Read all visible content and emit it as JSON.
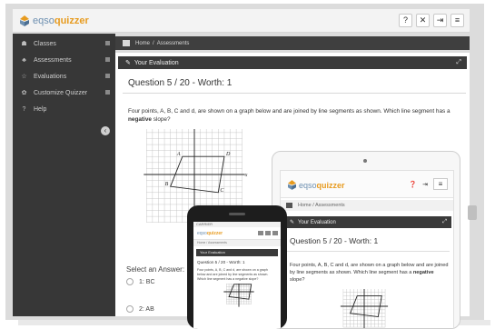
{
  "app": {
    "brand_light": "eqso",
    "brand_bold": "quizzer",
    "accent": "#e79b1f",
    "brand_blue": "#6d8fb0"
  },
  "toolbar": {
    "buttons": [
      {
        "icon": "help-icon",
        "glyph": "?"
      },
      {
        "icon": "fullscreen-icon",
        "glyph": "✕"
      },
      {
        "icon": "logout-icon",
        "glyph": "⇥"
      },
      {
        "icon": "menu-icon",
        "glyph": "≡"
      }
    ]
  },
  "sidebar": {
    "items": [
      {
        "label": "Classes",
        "icon": "users-icon",
        "glyph": "☗"
      },
      {
        "label": "Assessments",
        "icon": "sitemap-icon",
        "glyph": "♣"
      },
      {
        "label": "Evaluations",
        "icon": "star-icon",
        "glyph": "☆"
      },
      {
        "label": "Customize Quizzer",
        "icon": "gears-icon",
        "glyph": "✿"
      },
      {
        "label": "Help",
        "icon": "help-circle-icon",
        "glyph": "?"
      }
    ],
    "toggle_glyph": "‹"
  },
  "breadcrumb": {
    "home": "Home",
    "separator": "/",
    "current": "Assessments"
  },
  "panel": {
    "title": "Your Evaluation",
    "question_title": "Question 5 / 20 - Worth: 1",
    "question_text_pre": "Four points, A, B, C and d, are shown on a graph below and are joined by line segments as shown. Which line segment has a ",
    "question_text_bold": "negative",
    "question_text_post": " slope?"
  },
  "graph": {
    "points": [
      {
        "label": "A",
        "x": -2,
        "y": 3
      },
      {
        "label": "B",
        "x": -4,
        "y": -2
      },
      {
        "label": "C",
        "x": 4,
        "y": -3
      },
      {
        "label": "D",
        "x": 5,
        "y": 3
      }
    ],
    "axis_x": "x",
    "axis_y": "y"
  },
  "answers": {
    "label": "Select an Answer:",
    "options": [
      {
        "label": "1: BC"
      },
      {
        "label": "2: AB"
      }
    ]
  },
  "tablet": {
    "brand_light": "eqso",
    "brand_bold": "quizzer",
    "breadcrumb": "Home  /  Assessments",
    "panel_title": "Your Evaluation",
    "question_title": "Question 5 / 20 - Worth: 1",
    "question_text_pre": "Four points, A, B, C and d, are shown on a graph below and are joined by line segments as shown. Which line segment has a ",
    "question_text_bold": "negative",
    "question_text_post": " slope?"
  },
  "phone": {
    "status": "CARRIER",
    "brand_light": "eqso",
    "brand_bold": "quizzer",
    "breadcrumb": "Home  /  Assessments",
    "panel_title": "Your Evaluation",
    "question_title": "Question 5 / 20 - Worth: 1",
    "question_text": "Four points, A, B, C and d, are shown on a graph below and are joined by line segments as shown. Which line segment has a negative slope?"
  }
}
